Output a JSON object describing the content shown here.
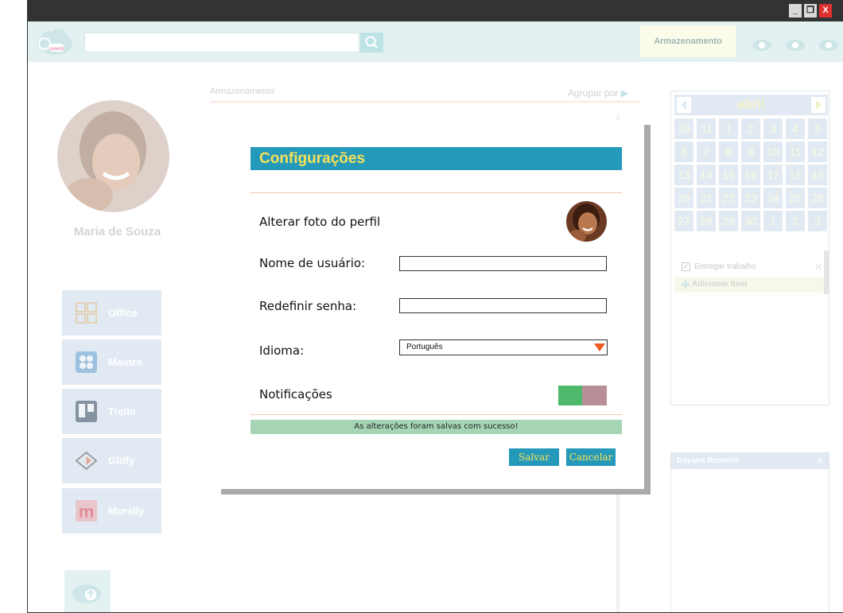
{
  "window": {
    "controls": {
      "minimize": "_",
      "maximize": "❐",
      "close": "X"
    }
  },
  "toolbar": {
    "logo_text": "nuvem",
    "search": {
      "placeholder": "",
      "icon": "search-icon"
    },
    "storage_button": "Armazenamento",
    "icons": [
      "settings-icon",
      "notifications-icon",
      "user-icon"
    ]
  },
  "profile": {
    "name": "Maria de Souza",
    "apps": [
      {
        "label": "Office",
        "icon": "office-icon"
      },
      {
        "label": "Moxtra",
        "icon": "moxtra-icon"
      },
      {
        "label": "Trello",
        "icon": "trello-icon"
      },
      {
        "label": "Gliffy",
        "icon": "gliffy-icon"
      },
      {
        "label": "Murally",
        "icon": "murally-icon"
      }
    ],
    "upload_icon": "upload-icon"
  },
  "content": {
    "section_label": "Armazenamento",
    "group_by": "Agrupar por"
  },
  "calendar": {
    "month": "abril",
    "weeks": [
      [
        "30",
        "31",
        "1",
        "2",
        "3",
        "4",
        "5"
      ],
      [
        "6",
        "7",
        "8",
        "9",
        "10",
        "11",
        "12"
      ],
      [
        "13",
        "14",
        "15",
        "16",
        "17",
        "18",
        "19"
      ],
      [
        "20",
        "21",
        "22",
        "23",
        "24",
        "25",
        "26"
      ],
      [
        "27",
        "28",
        "29",
        "30",
        "1",
        "2",
        "3"
      ]
    ],
    "tasks": [
      {
        "label": "Entregar trabalho",
        "checked": true
      }
    ],
    "add_item": "Adicionar Item"
  },
  "chat": {
    "contact": "Dayana Romeiro",
    "close": "✕"
  },
  "modal": {
    "title": "Configurações",
    "fields": {
      "photo_label": "Alterar foto do perfil",
      "username_label": "Nome de usuário:",
      "username_value": "",
      "password_label": "Redefinir senha:",
      "password_value": "",
      "language_label": "Idioma:",
      "language_value": "Português",
      "notifications_label": "Notificações",
      "notifications_on": true
    },
    "success_message": "As alterações foram salvas com sucesso!",
    "save_button": "Salvar",
    "cancel_button": "Cancelar"
  },
  "colors": {
    "accent": "#2499ba",
    "title_text": "#f5e15a",
    "success": "#a6d5b5",
    "toggle_on": "#4fb96b",
    "toggle_off": "#b88f98",
    "dropdown_arrow": "#ee5a24"
  }
}
